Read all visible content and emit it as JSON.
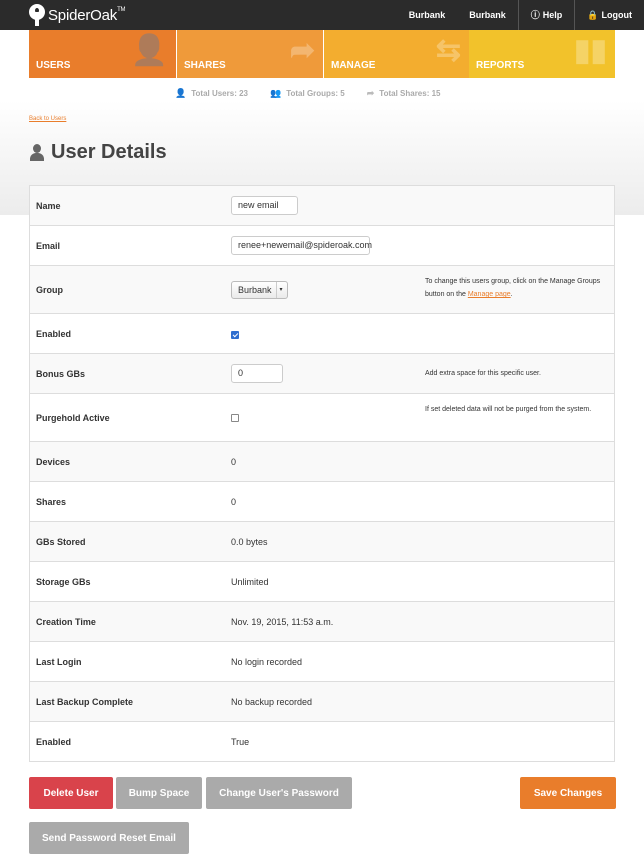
{
  "brand": {
    "name": "SpiderOak",
    "tm": "TM"
  },
  "topnav": {
    "items": [
      {
        "label": "Burbank"
      },
      {
        "label": "Burbank"
      }
    ],
    "help_label": "Help",
    "logout_label": "Logout"
  },
  "tabs": [
    {
      "label": "USERS",
      "icon": "user-icon",
      "active": true
    },
    {
      "label": "SHARES",
      "icon": "share-icon"
    },
    {
      "label": "MANAGE",
      "icon": "arrows-icon"
    },
    {
      "label": "REPORTS",
      "icon": "bar-chart-icon"
    }
  ],
  "stats": {
    "users": "Total Users: 23",
    "groups": "Total Groups: 5",
    "shares": "Total Shares: 15"
  },
  "back_link": "Back to Users",
  "page_title": "User Details",
  "details": {
    "name_label": "Name",
    "name_value": "new email",
    "email_label": "Email",
    "email_value": "renee+newemail@spideroak.com",
    "group_label": "Group",
    "group_value": "Burbank",
    "group_help_pre": "To change this users group, click on the Manage Groups button on the",
    "group_help_link": "Manage page",
    "group_help_post": ".",
    "enabled_label": "Enabled",
    "enabled_checked": true,
    "bonus_label": "Bonus GBs",
    "bonus_value": "0",
    "bonus_help": "Add extra space for this specific user.",
    "purgehold_label": "Purgehold Active",
    "purgehold_checked": false,
    "purgehold_help": "If set deleted data will not be purged from the system.",
    "devices_label": "Devices",
    "devices_value": "0",
    "shares_label": "Shares",
    "shares_value": "0",
    "stored_label": "GBs Stored",
    "stored_value": "0.0 bytes",
    "storage_label": "Storage GBs",
    "storage_value": "Unlimited",
    "created_label": "Creation Time",
    "created_value": "Nov. 19, 2015, 11:53 a.m.",
    "login_label": "Last Login",
    "login_value": "No login recorded",
    "backup_label": "Last Backup Complete",
    "backup_value": "No backup recorded",
    "enabled2_label": "Enabled",
    "enabled2_value": "True"
  },
  "buttons": {
    "delete": "Delete User",
    "bump": "Bump Space",
    "change_password": "Change User's Password",
    "save": "Save Changes",
    "reset_email": "Send Password Reset Email"
  },
  "colors": {
    "accent": "#e97d2b",
    "danger": "#d9434b",
    "neutral_button": "#aaaaaa",
    "topbar": "#2b2b2b"
  }
}
